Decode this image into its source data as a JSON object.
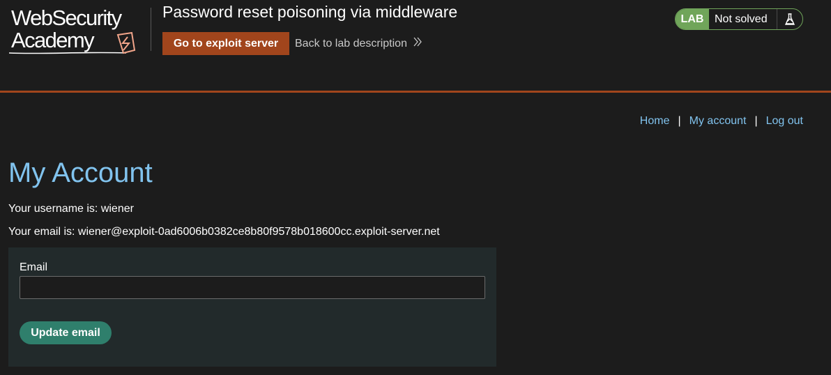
{
  "header": {
    "logo": {
      "line1": "WebSecurity",
      "line2": "Academy"
    },
    "lab_title": "Password reset poisoning via middleware",
    "exploit_button": "Go to exploit server",
    "back_link": "Back to lab description",
    "lab_badge": "LAB",
    "status": "Not solved",
    "colors": {
      "accent": "#a1451c",
      "status_green": "#70a55a"
    }
  },
  "nav": {
    "home": "Home",
    "separator": "|",
    "my_account": "My account",
    "log_out": "Log out"
  },
  "main": {
    "title": "My Account",
    "username_line": "Your username is: wiener",
    "email_line": "Your email is: wiener@exploit-0ad6006b0382ce8b80f9578b018600cc.exploit-server.net",
    "form": {
      "email_label": "Email",
      "email_value": "",
      "submit_label": "Update email"
    }
  },
  "icons": {
    "back_chevron": "double-chevron-right-icon",
    "flask": "flask-icon",
    "logo": "lightning-bolt-logo-icon"
  }
}
